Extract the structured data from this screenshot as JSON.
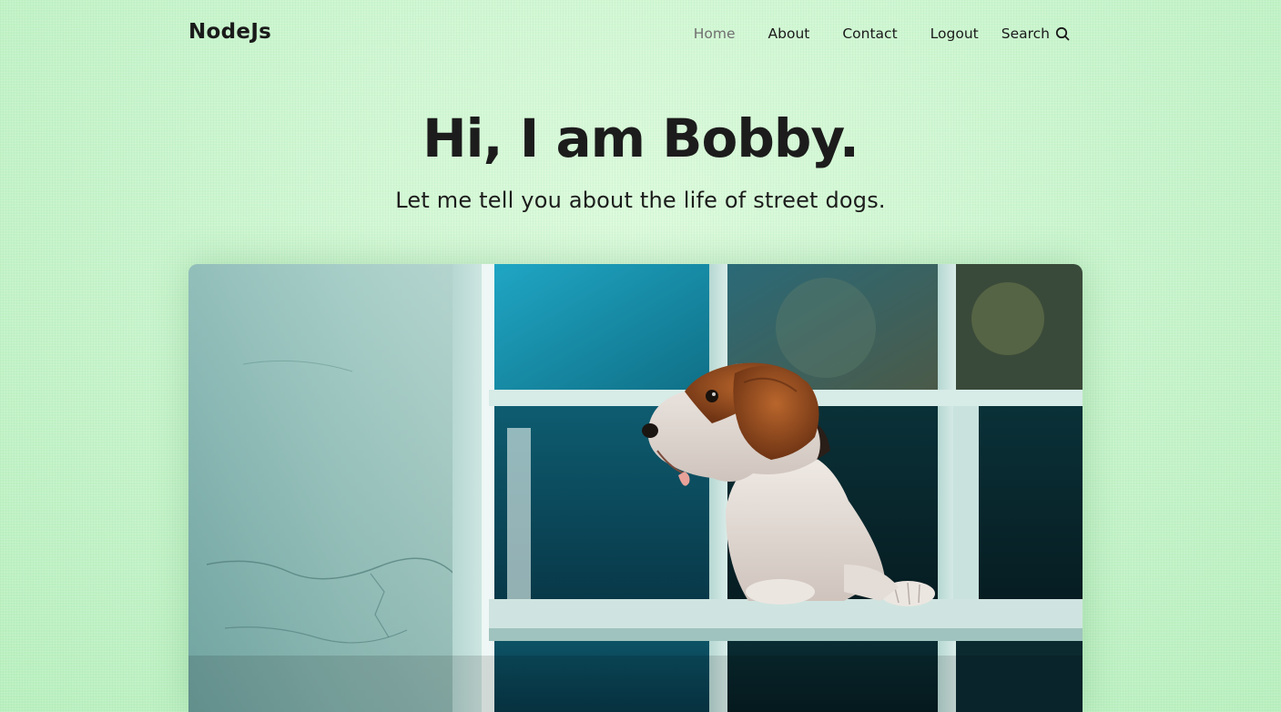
{
  "header": {
    "logo": "NodeJs",
    "nav": {
      "home": "Home",
      "about": "About",
      "contact": "Contact",
      "logout": "Logout",
      "search": "Search",
      "search_icon": "search-icon"
    }
  },
  "hero": {
    "title": "Hi, I am Bobby.",
    "subtitle": "Let me tell you about the life of street dogs."
  },
  "image": {
    "alt": "A beagle dog leaning out of a window with white painted frames"
  },
  "colors": {
    "background": "#c9f5cf",
    "text": "#1c1c1c",
    "nav_active": "#6f6f6f"
  }
}
